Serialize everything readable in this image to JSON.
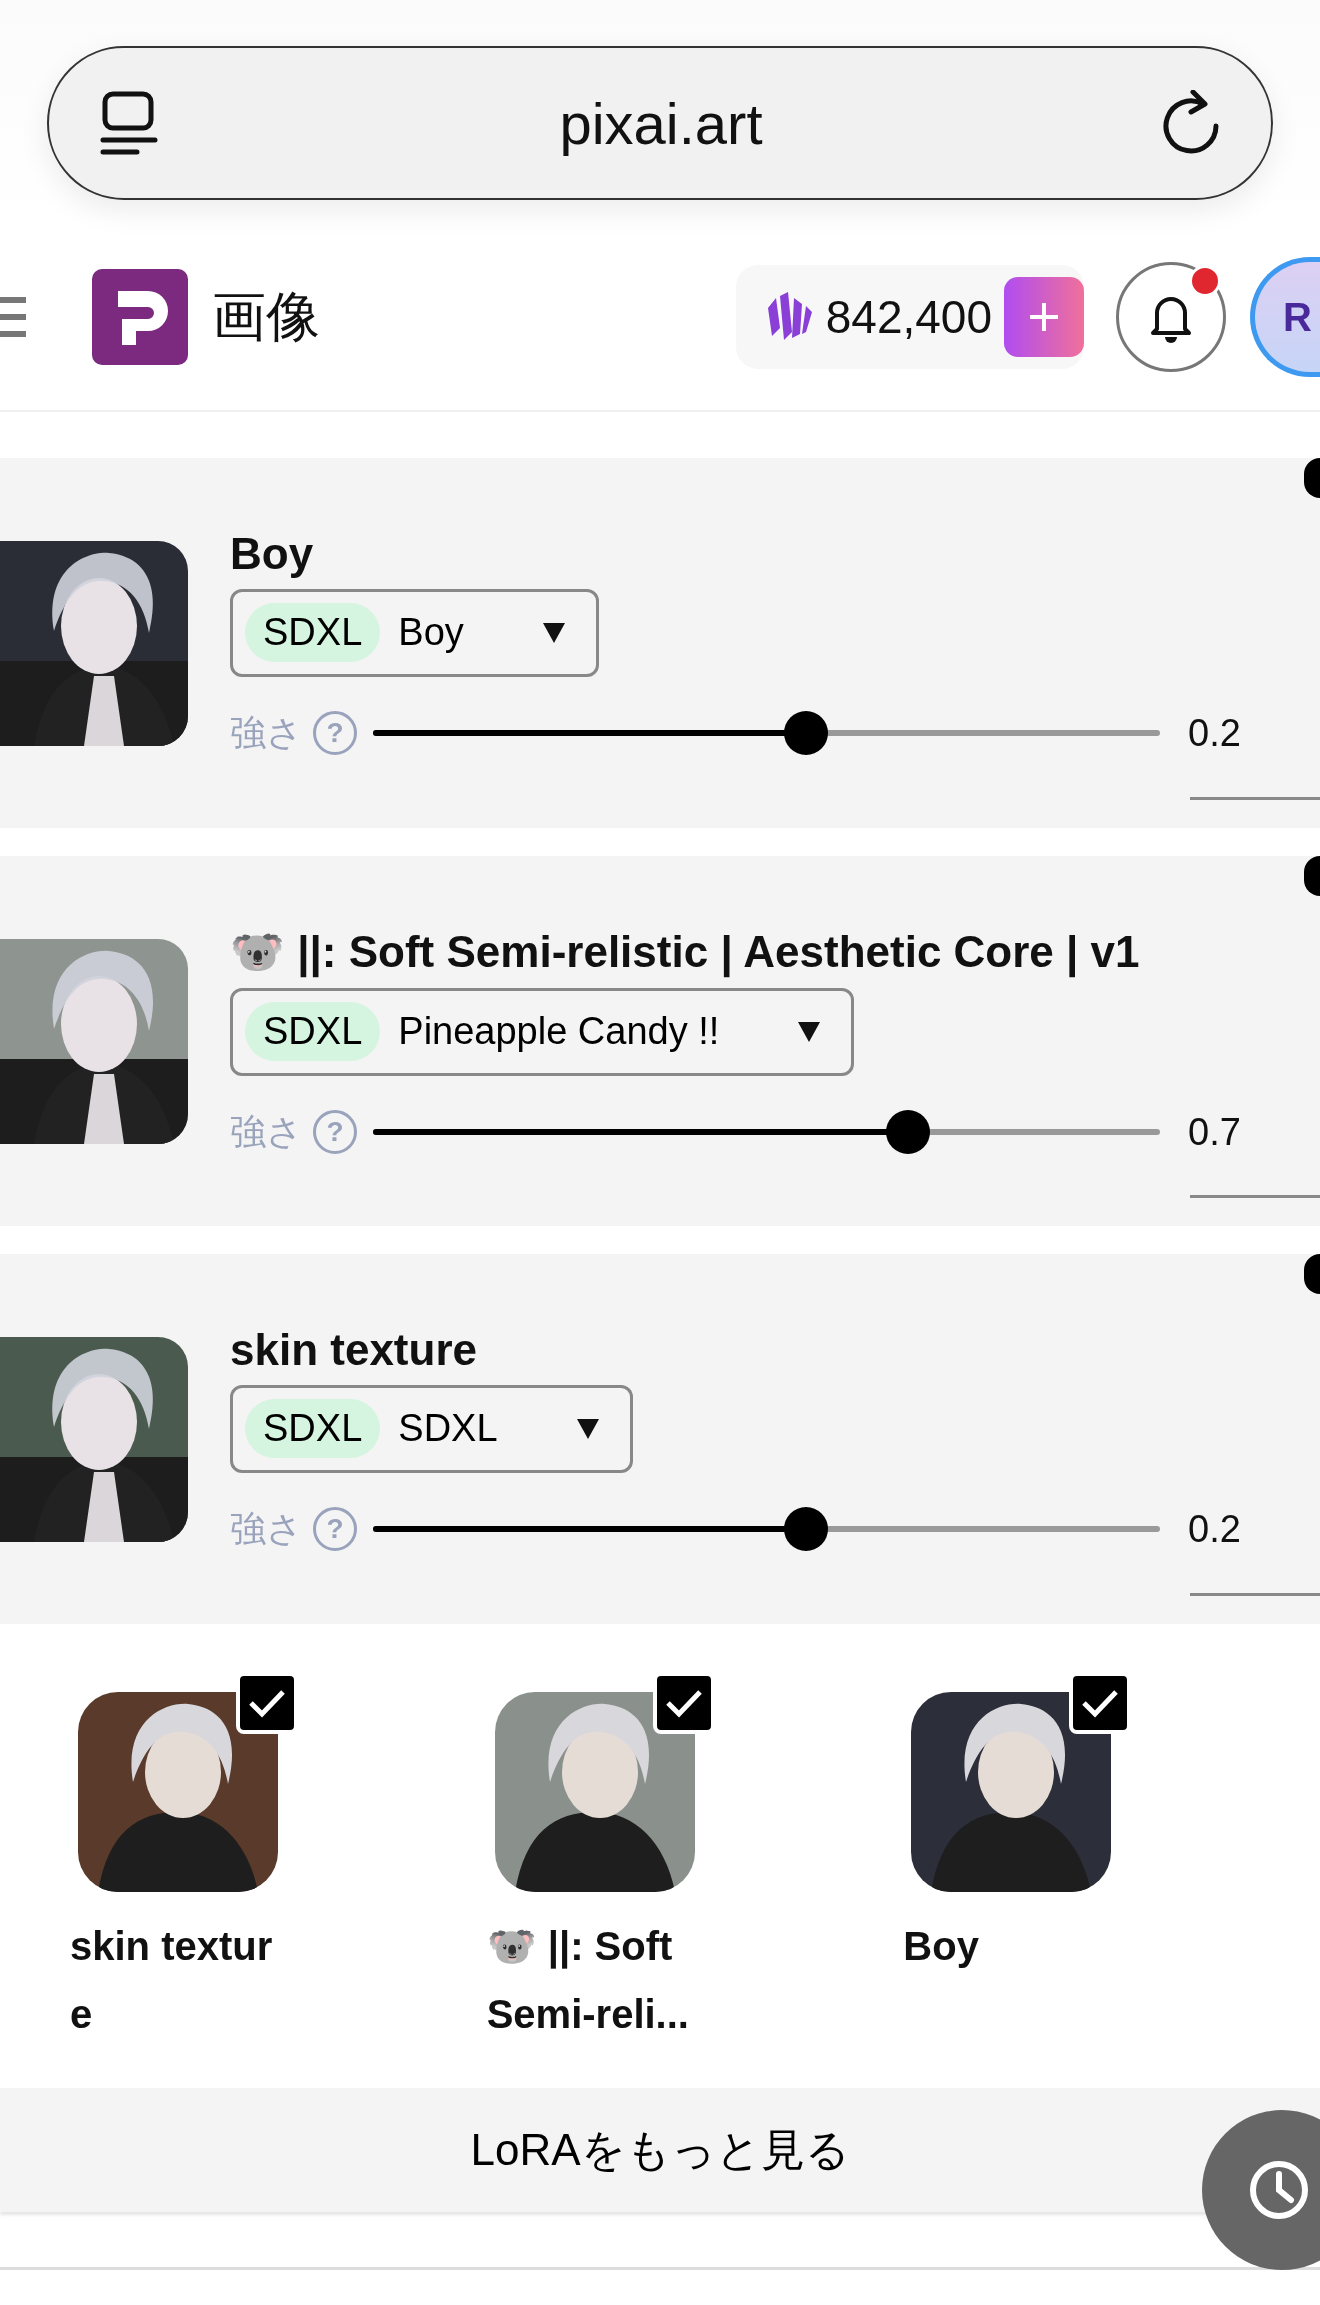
{
  "browser": {
    "url": "pixai.art"
  },
  "header": {
    "title": "画像",
    "credits": "842,400",
    "notification_unread": true,
    "avatar_initials": "R"
  },
  "loras": [
    {
      "title": "Boy",
      "base": "SDXL",
      "version": "Boy",
      "strength_label": "強さ",
      "help": "?",
      "level": 0.55,
      "value": "0.2"
    },
    {
      "title": "🐨 ||: Soft Semi-relistic | Aesthetic Core | v1",
      "base": "SDXL",
      "version": "Pineapple Candy !!",
      "strength_label": "強さ",
      "help": "?",
      "level": 0.68,
      "value": "0.7"
    },
    {
      "title": "skin texture",
      "base": "SDXL",
      "version": "SDXL",
      "strength_label": "強さ",
      "help": "?",
      "level": 0.55,
      "value": "0.2"
    }
  ],
  "selected_loras": [
    {
      "name": "skin texture",
      "checked": true
    },
    {
      "name": "🐨 ||: Soft Semi-reli...",
      "checked": true
    },
    {
      "name": "Boy",
      "checked": true
    }
  ],
  "more_button": "LoRAをもっと見る"
}
